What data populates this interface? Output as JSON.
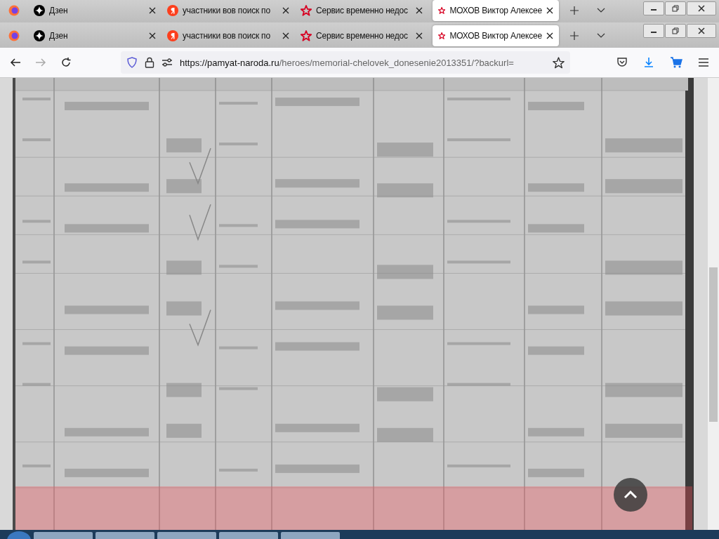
{
  "tab_strips": [
    {
      "tabs": [
        {
          "label": "Дзен",
          "selected": false
        },
        {
          "label": "участники вов поиск по",
          "selected": false
        },
        {
          "label": "Сервис временно недос",
          "selected": false
        },
        {
          "label": "МОХОВ Виктор Алексее",
          "selected": true
        }
      ]
    },
    {
      "tabs": [
        {
          "label": "Дзен",
          "selected": false
        },
        {
          "label": "участники вов поиск по",
          "selected": false
        },
        {
          "label": "Сервис временно недос",
          "selected": false
        },
        {
          "label": "МОХОВ Виктор Алексее",
          "selected": true
        }
      ]
    }
  ],
  "address_bar": {
    "host": "https://pamyat-naroda.ru",
    "path": "/heroes/memorial-chelovek_donesenie2013351/?backurl="
  }
}
